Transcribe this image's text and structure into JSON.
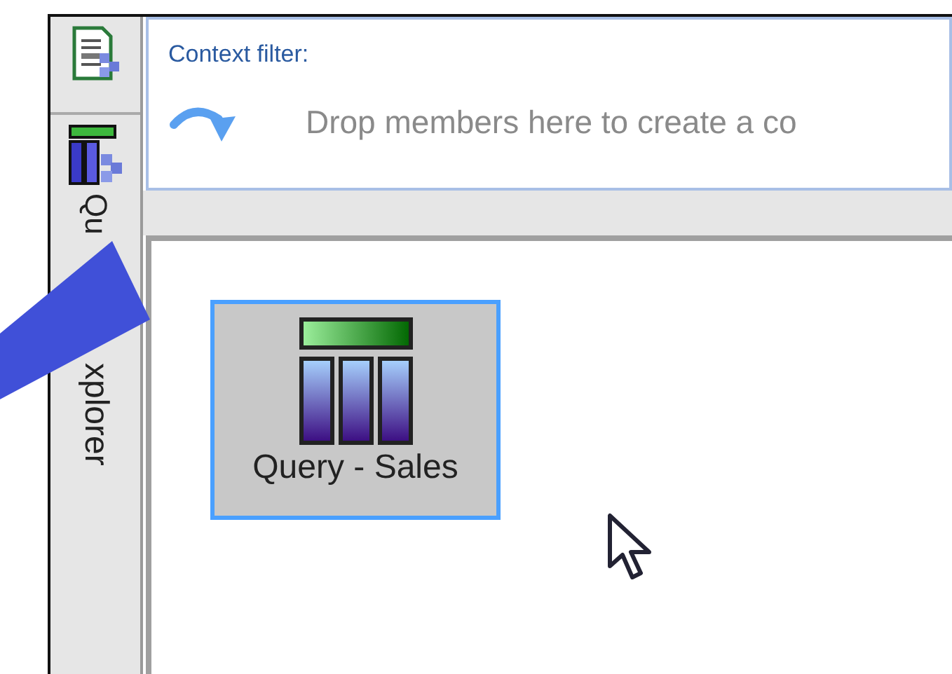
{
  "sidebar": {
    "tab_label_parts": [
      "Qu",
      "xplorer"
    ]
  },
  "context_filter": {
    "label": "Context filter:",
    "hint": "Drop members here to create a co"
  },
  "canvas": {
    "items": [
      {
        "label": "Query - Sales",
        "selected": true
      }
    ]
  }
}
